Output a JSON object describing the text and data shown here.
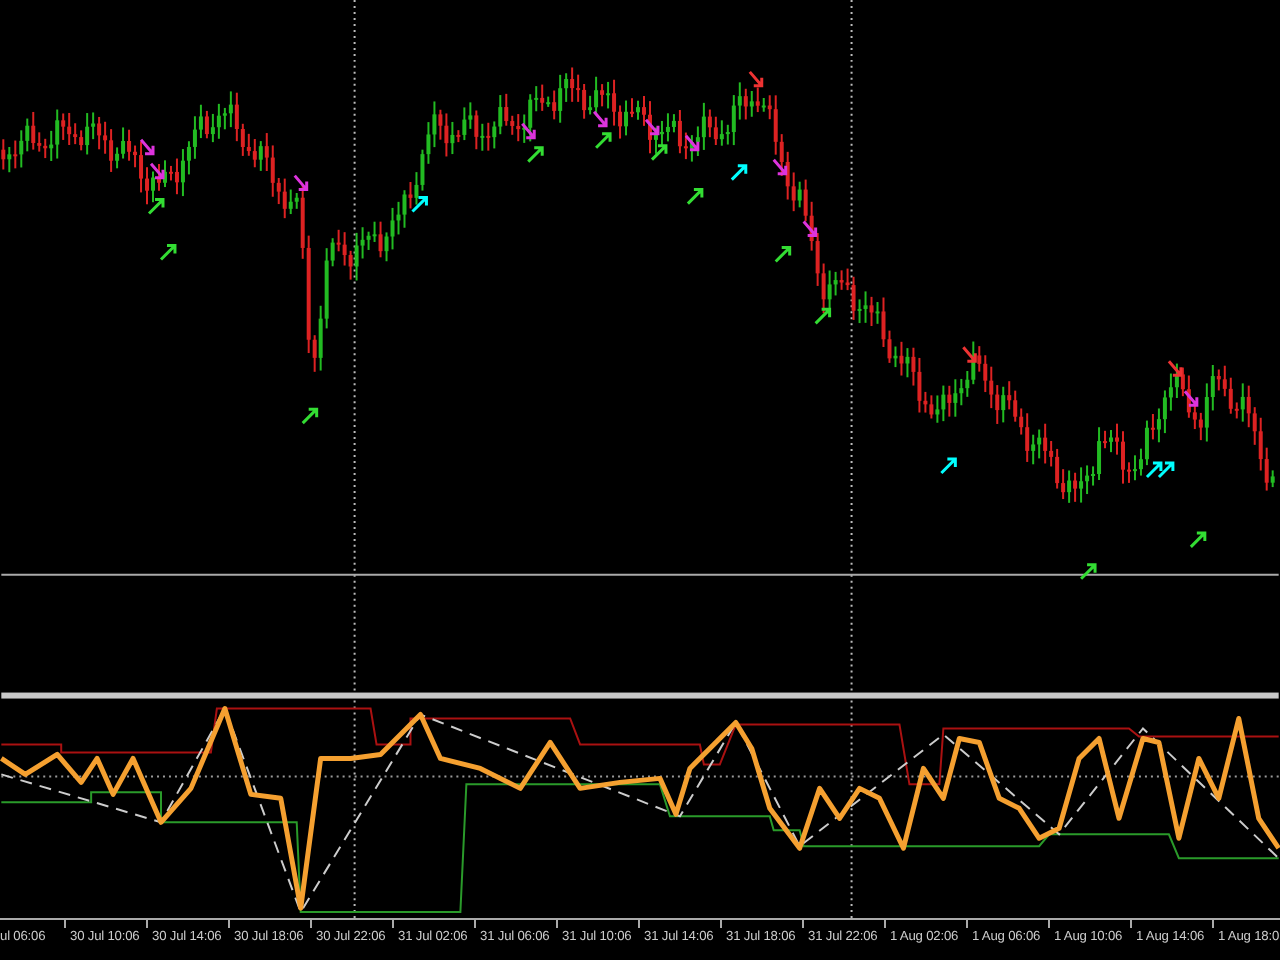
{
  "time_axis": {
    "labels": [
      "ul 06:06",
      "30 Jul 10:06",
      "30 Jul 14:06",
      "30 Jul 18:06",
      "30 Jul 22:06",
      "31 Jul 02:06",
      "31 Jul 06:06",
      "31 Jul 10:06",
      "31 Jul 14:06",
      "31 Jul 18:06",
      "31 Jul 22:06",
      "1 Aug 02:06",
      "1 Aug 06:06",
      "1 Aug 10:06",
      "1 Aug 14:06",
      "1 Aug 18:0"
    ]
  }
}
